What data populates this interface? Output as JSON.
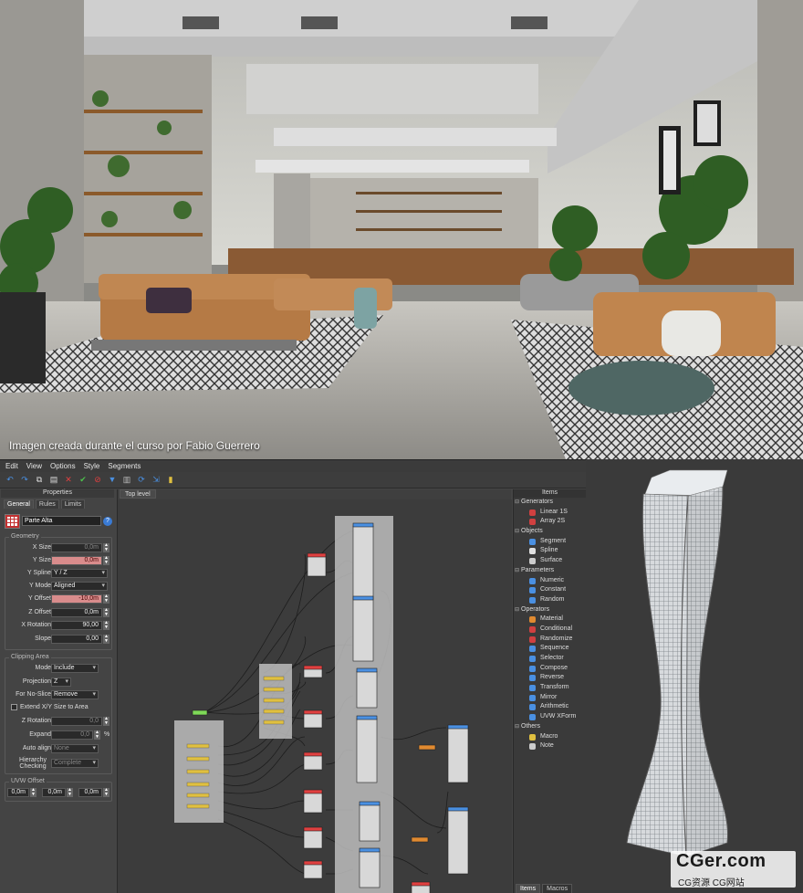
{
  "render": {
    "caption": "Imagen creada durante el curso por Fabio Guerrero"
  },
  "menu": [
    "Edit",
    "View",
    "Options",
    "Style",
    "Segments"
  ],
  "toolbar_icons": [
    "undo-icon",
    "redo-icon",
    "copy-icon",
    "paste-icon",
    "delete-icon",
    "accept-icon",
    "stop-icon",
    "filter-icon",
    "clipboard-icon",
    "refresh-icon",
    "export-icon",
    "layout-icon"
  ],
  "properties": {
    "title": "Properties",
    "tabs": [
      "General",
      "Rules",
      "Limits"
    ],
    "name": "Parte Alta",
    "help": "?",
    "geometry": {
      "title": "Geometry",
      "x_size_label": "X Size",
      "x_size": "0,0m",
      "y_size_label": "Y Size",
      "y_size": "0,0m",
      "y_spline_label": "Y Spline",
      "y_spline": "Y / Z",
      "y_mode_label": "Y Mode",
      "y_mode": "Aligned",
      "y_offset_label": "Y Offset",
      "y_offset": "-10,0m",
      "z_offset_label": "Z Offset",
      "z_offset": "0,0m",
      "x_rotation_label": "X Rotation",
      "x_rotation": "90,00",
      "slope_label": "Slope",
      "slope": "0,00"
    },
    "clipping": {
      "title": "Clipping Area",
      "mode_label": "Mode",
      "mode": "Include",
      "projection_label": "Projection",
      "projection": "Z",
      "noslice_label": "For No-Slice",
      "noslice": "Remove",
      "extend_label": "Extend X/Y Size to Area",
      "z_rotation_label": "Z Rotation",
      "z_rotation": "0,0",
      "expand_label": "Expand",
      "expand": "0,0",
      "expand_unit": "%",
      "autoalign_label": "Auto align",
      "autoalign": "None",
      "hierarchy_label": "Hierarchy Checking",
      "hierarchy": "Complete"
    },
    "uvw": {
      "title": "UVW Offset",
      "u": "0,0m",
      "v": "0,0m",
      "w": "0,0m"
    }
  },
  "canvas": {
    "tab": "Top level"
  },
  "items": {
    "title": "Items",
    "groups": [
      {
        "name": "Generators",
        "items": [
          {
            "label": "Linear 1S",
            "color": "#d04040"
          },
          {
            "label": "Array 2S",
            "color": "#d04040"
          }
        ]
      },
      {
        "name": "Objects",
        "items": [
          {
            "label": "Segment",
            "color": "#4a90e2"
          },
          {
            "label": "Spline",
            "color": "#e0e0e0"
          },
          {
            "label": "Surface",
            "color": "#cccccc"
          }
        ]
      },
      {
        "name": "Parameters",
        "items": [
          {
            "label": "Numeric",
            "color": "#4a90e2"
          },
          {
            "label": "Constant",
            "color": "#4a90e2"
          },
          {
            "label": "Random",
            "color": "#4a90e2"
          }
        ]
      },
      {
        "name": "Operators",
        "items": [
          {
            "label": "Material",
            "color": "#e08a30"
          },
          {
            "label": "Conditional",
            "color": "#d04040"
          },
          {
            "label": "Randomize",
            "color": "#d04040"
          },
          {
            "label": "Sequence",
            "color": "#4a90e2"
          },
          {
            "label": "Selector",
            "color": "#4a90e2"
          },
          {
            "label": "Compose",
            "color": "#4a90e2"
          },
          {
            "label": "Reverse",
            "color": "#4a90e2"
          },
          {
            "label": "Transform",
            "color": "#4a90e2"
          },
          {
            "label": "Mirror",
            "color": "#4a90e2"
          },
          {
            "label": "Arithmetic",
            "color": "#4a90e2"
          },
          {
            "label": "UVW XForm",
            "color": "#4a90e2"
          }
        ]
      },
      {
        "name": "Others",
        "items": [
          {
            "label": "Macro",
            "color": "#e0c040"
          },
          {
            "label": "Note",
            "color": "#cccccc"
          }
        ]
      }
    ],
    "tabs": [
      "Items",
      "Macros"
    ]
  },
  "watermark": {
    "big": "CGer.com",
    "small": "CG资源 CG网站"
  }
}
